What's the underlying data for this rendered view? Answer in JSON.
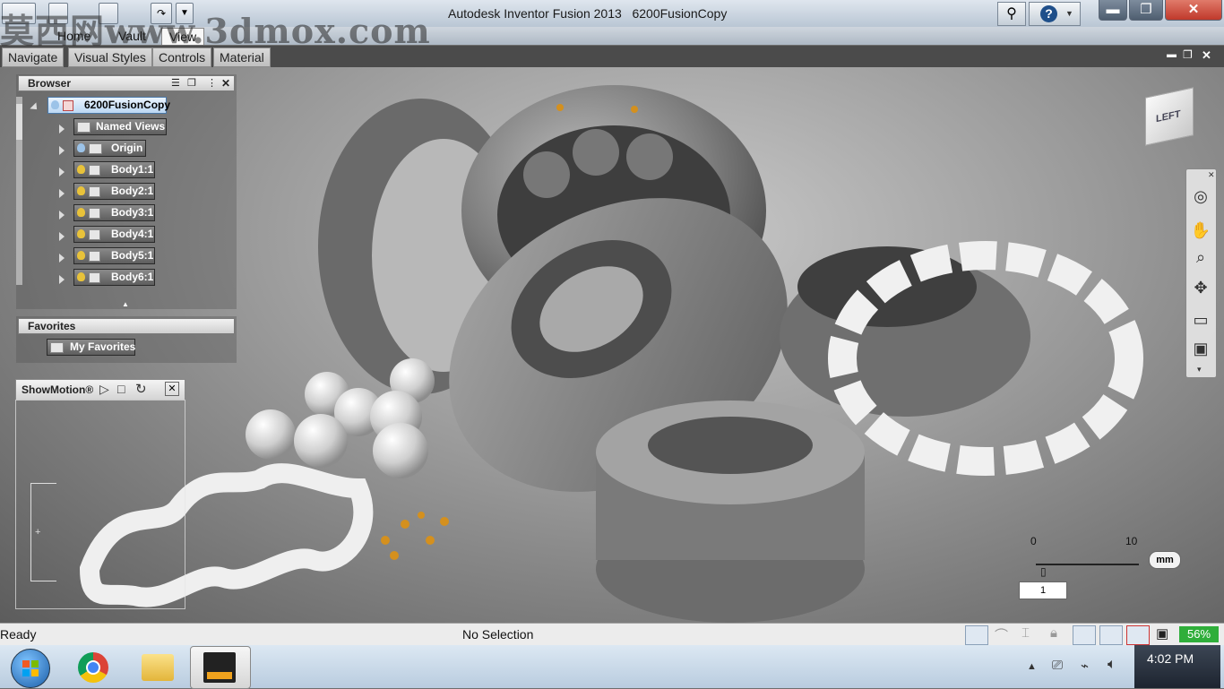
{
  "window": {
    "app_title": "Autodesk Inventor Fusion 2013",
    "doc_title": "6200FusionCopy",
    "watermark": "莫西网www.3dmox.com"
  },
  "ribbon_tabs": [
    "Home",
    "Vault",
    "View"
  ],
  "menubar": [
    "Navigate",
    "Visual Styles",
    "Controls",
    "Material"
  ],
  "browser": {
    "title": "Browser",
    "root": "6200FusionCopy",
    "nodes": [
      {
        "label": "Named Views",
        "icon": "folder"
      },
      {
        "label": "Origin",
        "icon": "folder"
      },
      {
        "label": "Body1:1",
        "icon": "body"
      },
      {
        "label": "Body2:1",
        "icon": "body"
      },
      {
        "label": "Body3:1",
        "icon": "body"
      },
      {
        "label": "Body4:1",
        "icon": "body"
      },
      {
        "label": "Body5:1",
        "icon": "body"
      },
      {
        "label": "Body6:1",
        "icon": "body"
      }
    ]
  },
  "favorites": {
    "title": "Favorites",
    "item": "My Favorites"
  },
  "showmotion": {
    "title": "ShowMotion®"
  },
  "viewcube": {
    "face": "LEFT"
  },
  "scale": {
    "min": "0",
    "max": "10",
    "unit": "mm",
    "value": "1"
  },
  "status": {
    "left": "Ready",
    "center": "No Selection",
    "battery": "56%"
  },
  "clock": {
    "time": "4:02 PM"
  },
  "colors": {
    "accent": "#3a76b8",
    "battery": "#2fae3a"
  }
}
